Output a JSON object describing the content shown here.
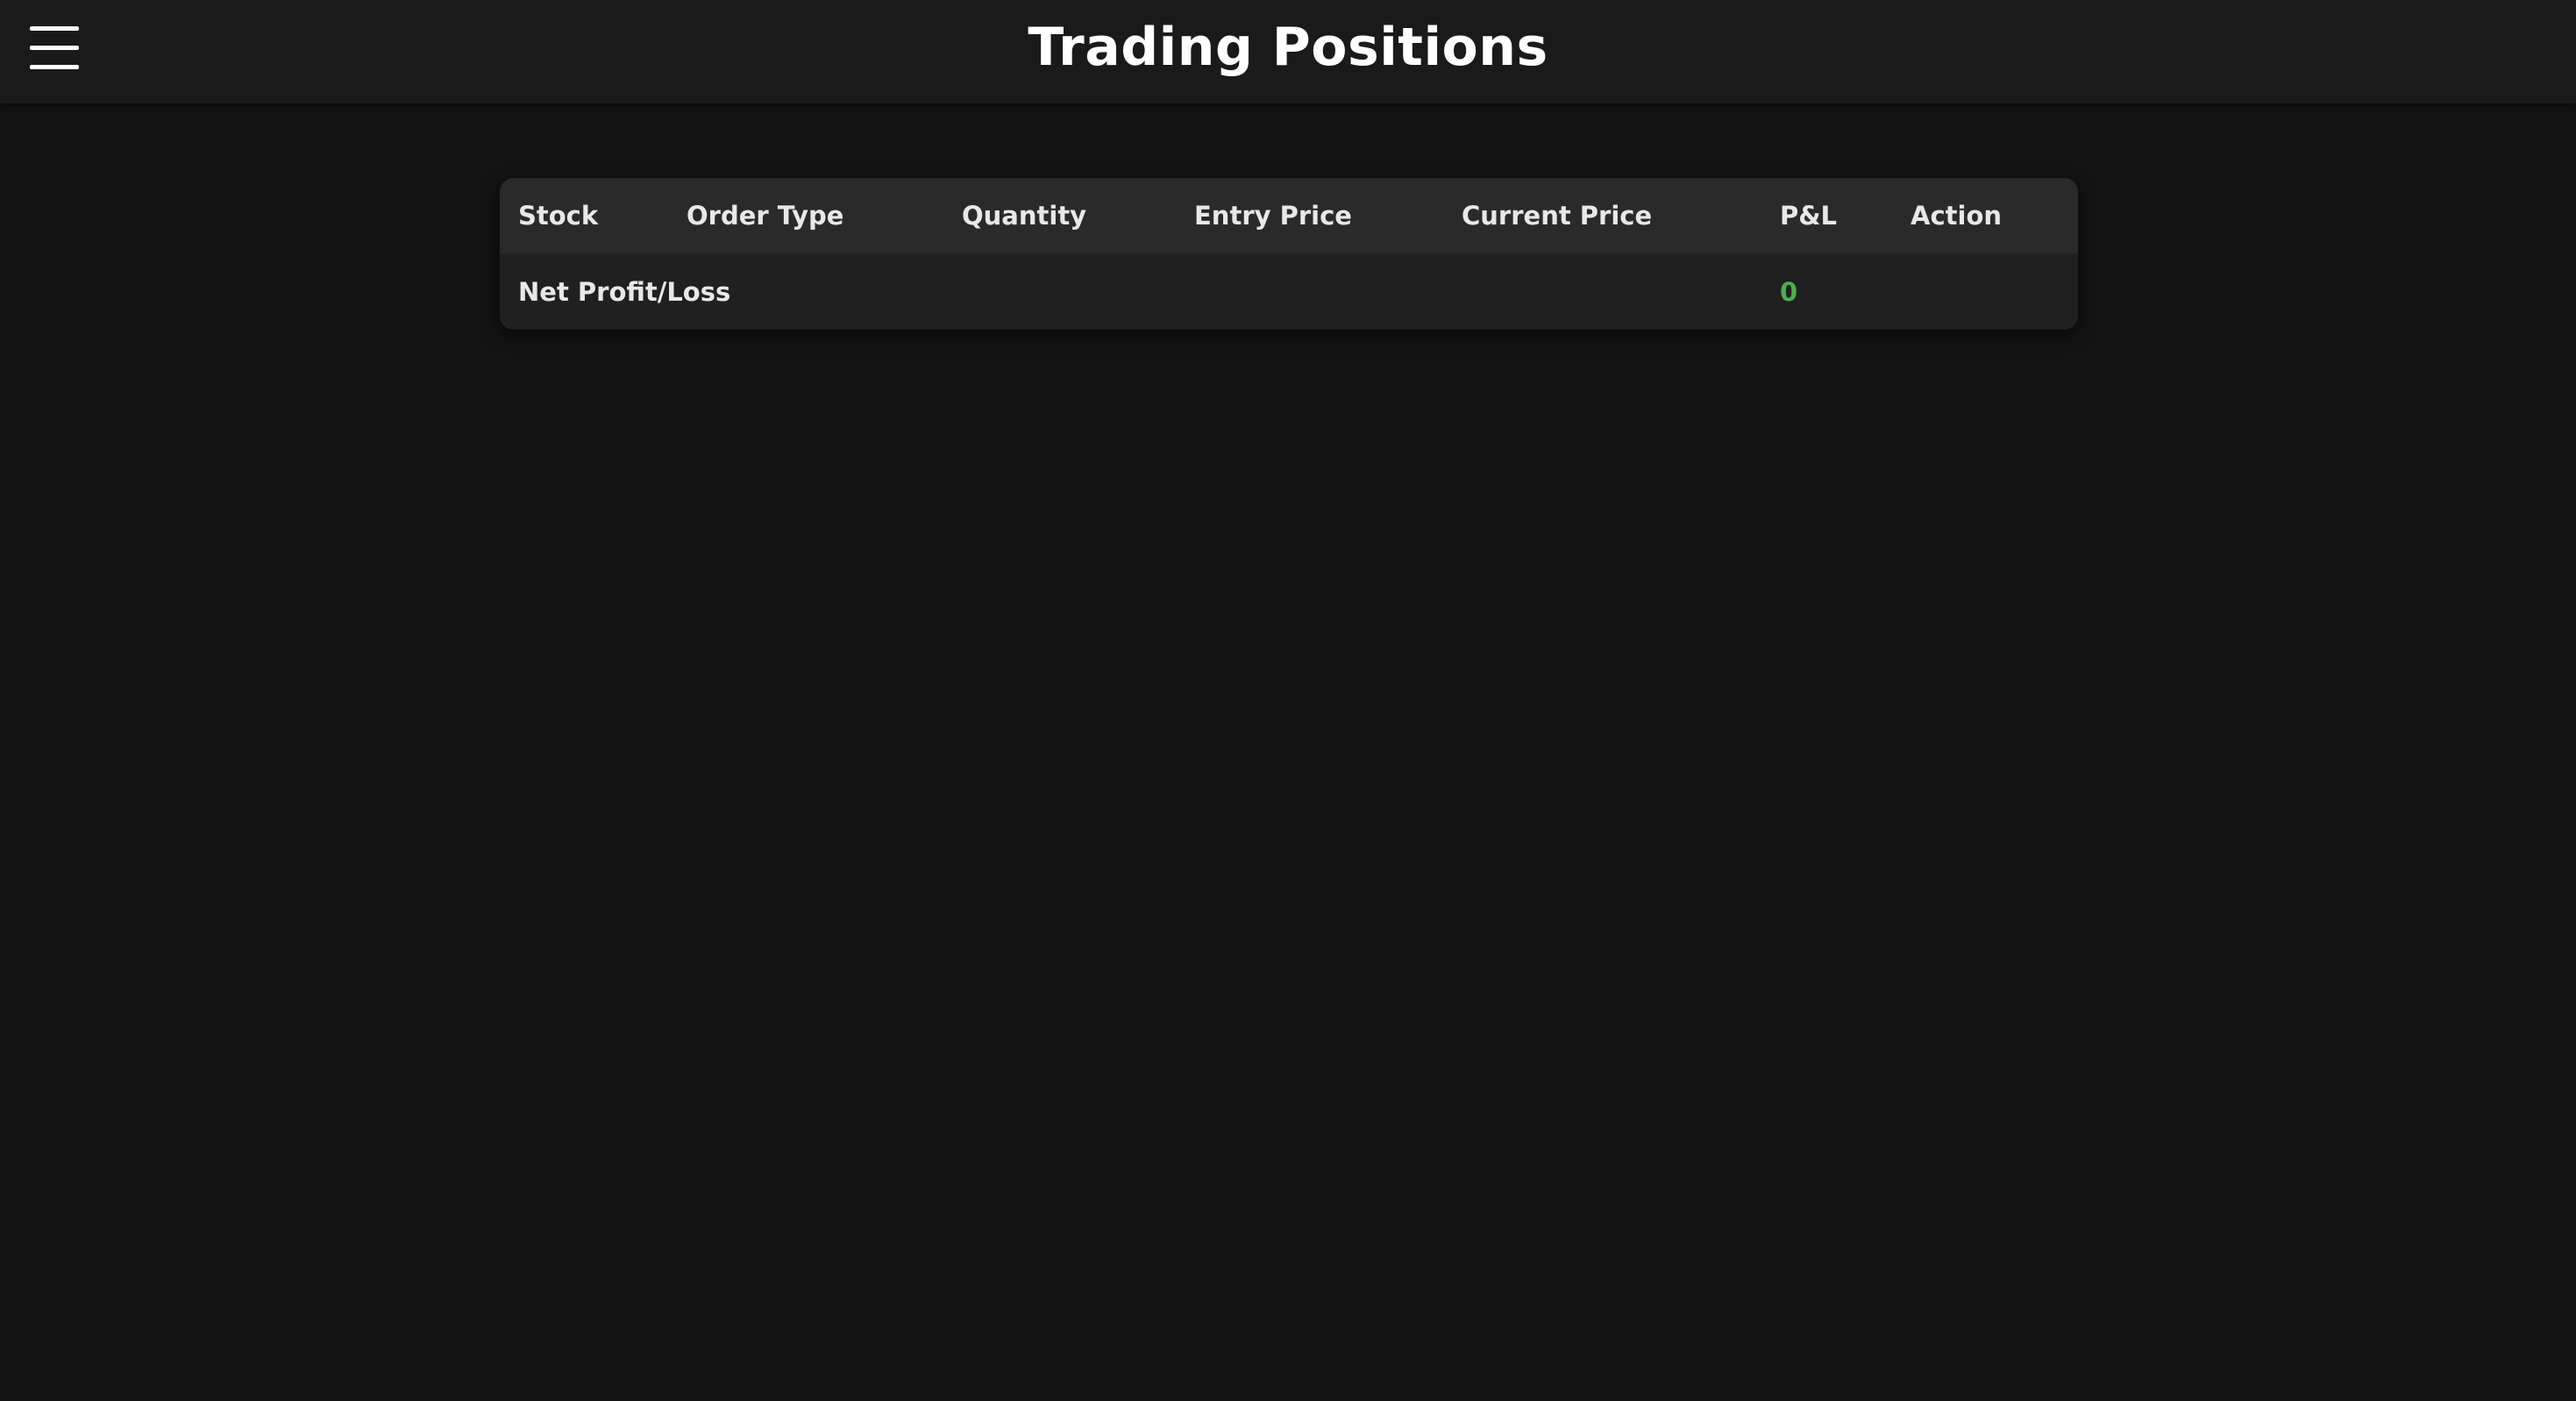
{
  "header": {
    "title": "Trading Positions",
    "menu_icon": "hamburger-menu-icon"
  },
  "table": {
    "columns": [
      "Stock",
      "Order Type",
      "Quantity",
      "Entry Price",
      "Current Price",
      "P&L",
      "Action"
    ],
    "rows": [],
    "footer": {
      "label": "Net Profit/Loss",
      "net_pnl": "0",
      "net_pnl_color": "#4caf50"
    }
  }
}
